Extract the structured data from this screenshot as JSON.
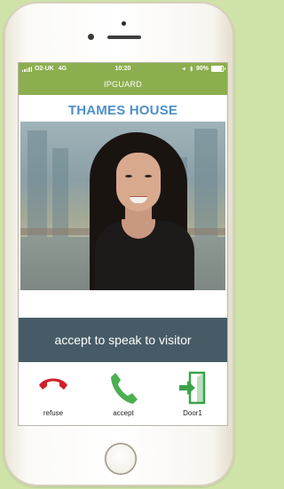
{
  "status_bar": {
    "carrier": "O2-UK",
    "network": "4G",
    "time": "10:20",
    "battery": "90%",
    "icons": [
      "signal-icon",
      "location-arrow-icon",
      "bluetooth-icon",
      "battery-icon"
    ]
  },
  "app": {
    "title": "IPGUARD"
  },
  "location": {
    "name": "THAMES HOUSE"
  },
  "banner": {
    "text": "accept to speak to visitor"
  },
  "actions": [
    {
      "label": "refuse",
      "icon": "phone-hangup-icon",
      "color": "#d0202a"
    },
    {
      "label": "accept",
      "icon": "phone-icon",
      "color": "#4caf50"
    },
    {
      "label": "Door1",
      "icon": "door-exit-icon",
      "color": "#3aa34a"
    }
  ],
  "colors": {
    "header_bg": "#8cae4e",
    "location_text": "#4d8fc9",
    "banner_bg": "#475b66",
    "page_bg": "#cfe3a8"
  }
}
